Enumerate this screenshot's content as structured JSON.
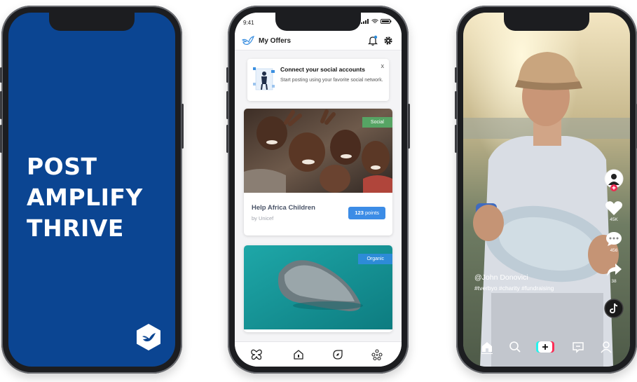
{
  "phone1": {
    "slogan_lines": [
      "POST",
      "AMPLIFY",
      "THRIVE"
    ],
    "logo_icon": "dove-hexagon-icon",
    "background_color": "#0b4592"
  },
  "phone2": {
    "status_time": "9:41",
    "header": {
      "title": "My Offers",
      "logo_icon": "dove-icon",
      "notification_icon": "bell-icon",
      "settings_icon": "gear-icon"
    },
    "banner": {
      "title": "Connect your social accounts",
      "subtitle": "Start posting using your favorite social network.",
      "close_label": "x"
    },
    "offers": [
      {
        "tag": "Social",
        "tag_color": "#56a464",
        "title": "Help Africa Children",
        "sponsor": "by Unicef",
        "points_value": "123",
        "points_unit": "points"
      },
      {
        "tag": "Organic",
        "tag_color": "#2d8bd8"
      }
    ],
    "tabbar_icons": [
      "butterfly-icon",
      "home-shield-icon",
      "compass-icon",
      "community-icon"
    ]
  },
  "phone3": {
    "handle": "@John Donovici",
    "hashtags": "#tverbyo #charity #fundraising",
    "like_count": "45K",
    "comment_count": "456",
    "share_count": "38",
    "icons": [
      "avatar-icon",
      "heart-icon",
      "comment-icon",
      "share-icon",
      "tiktok-icon"
    ],
    "nav_icons": [
      "home-icon",
      "search-icon",
      "create-icon",
      "inbox-icon",
      "profile-icon"
    ]
  }
}
